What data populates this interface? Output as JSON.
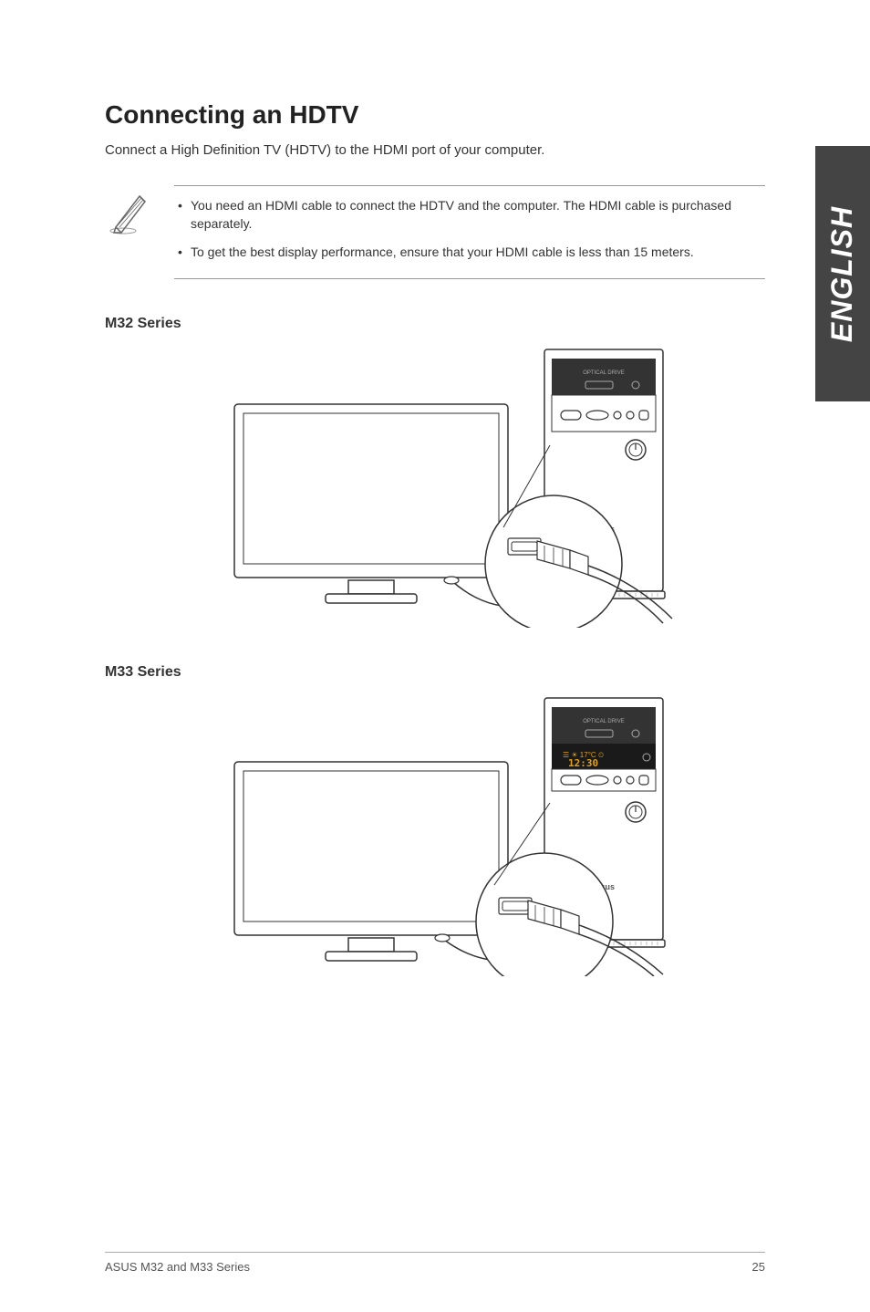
{
  "heading": "Connecting an HDTV",
  "intro": "Connect a High Definition TV (HDTV) to the HDMI port of your computer.",
  "notes": [
    "You need an HDMI cable to connect the HDTV and the computer. The HDMI cable is purchased separately.",
    "To get the best display performance, ensure that your HDMI cable is less than 15 meters."
  ],
  "series1_label": "M32 Series",
  "series2_label": "M33 Series",
  "lang_tab": "ENGLISH",
  "footer_left": "ASUS M32 and M33 Series",
  "footer_right": "25"
}
